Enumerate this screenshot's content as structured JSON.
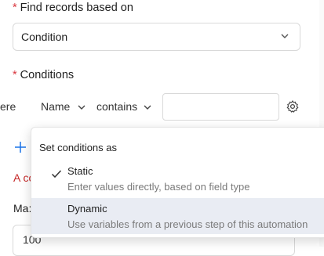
{
  "find": {
    "required_mark": "*",
    "label": "Find records based on",
    "selected": "Condition",
    "icon": "chevron-down-icon"
  },
  "conditions": {
    "required_mark": "*",
    "label": "Conditions",
    "where_label": "ere",
    "field": "Name",
    "operator": "contains",
    "value": "",
    "settings_icon": "gear-icon"
  },
  "add_icon": "plus-icon",
  "partial_red_text": "A co",
  "partial_max_text": "Ma:",
  "partial_input_value": "100",
  "popup": {
    "title": "Set conditions as",
    "options": [
      {
        "name": "Static",
        "description": "Enter values directly, based on field type",
        "checked": true
      },
      {
        "name": "Dynamic",
        "description": "Use variables from a previous step of this automation",
        "checked": false,
        "hovered": true
      }
    ]
  },
  "colors": {
    "required": "#d9363e",
    "accent": "#1a73e8",
    "hover_bg": "#e9ecf3"
  }
}
